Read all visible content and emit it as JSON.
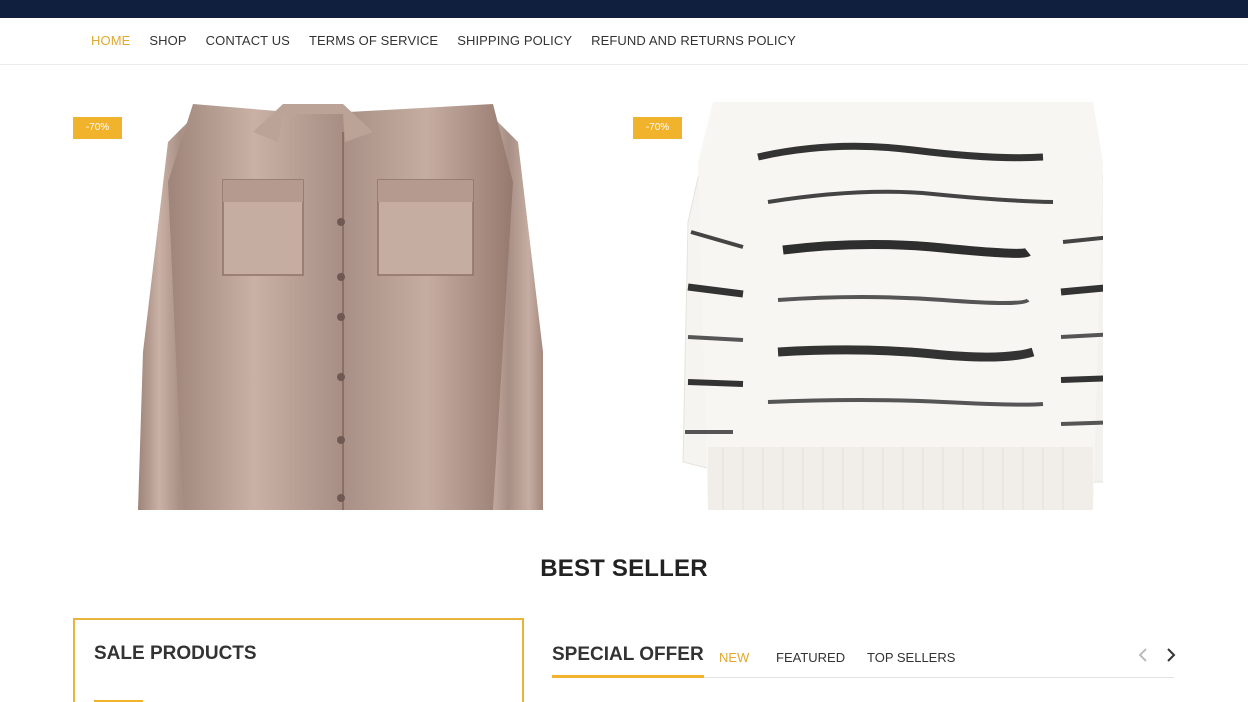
{
  "nav": {
    "items": [
      {
        "label": "HOME",
        "active": true
      },
      {
        "label": "SHOP",
        "active": false
      },
      {
        "label": "CONTACT US",
        "active": false
      },
      {
        "label": "TERMS OF SERVICE",
        "active": false
      },
      {
        "label": "SHIPPING POLICY",
        "active": false
      },
      {
        "label": "REFUND AND RETURNS POLICY",
        "active": false
      }
    ]
  },
  "products": [
    {
      "badge": "-70%",
      "image": "satin-shirt"
    },
    {
      "badge": "-70%",
      "image": "striped-sweater"
    }
  ],
  "best_seller": {
    "title": "BEST SELLER"
  },
  "sale_products": {
    "title": "SALE PRODUCTS"
  },
  "special_offer": {
    "title": "SPECIAL OFFER",
    "tabs": [
      {
        "label": "NEW",
        "active": true
      },
      {
        "label": "FEATURED",
        "active": false
      },
      {
        "label": "TOP SELLERS",
        "active": false
      }
    ],
    "prev_icon": "chevron-left-icon",
    "next_icon": "chevron-right-icon"
  },
  "colors": {
    "topbar": "#0f1f3d",
    "accent": "#f1b22c",
    "active_text": "#e0a92e"
  }
}
